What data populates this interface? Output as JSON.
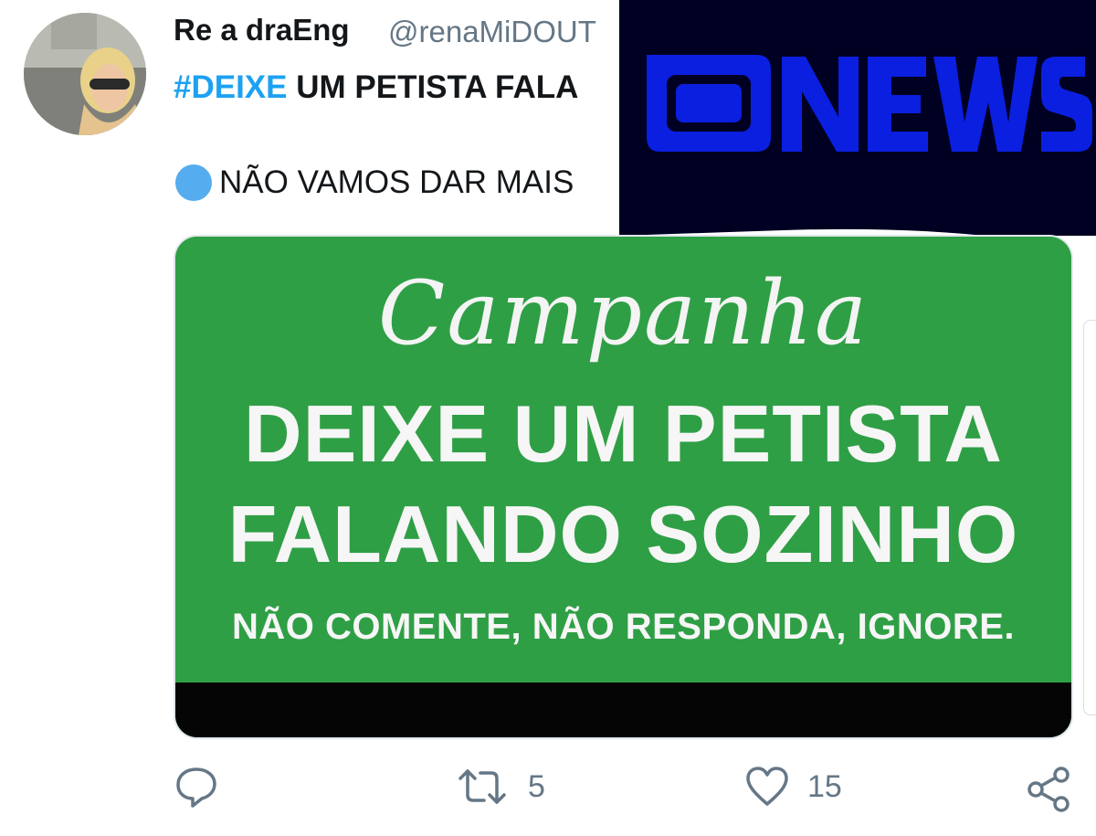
{
  "tweet": {
    "display_name": "Re a draEng",
    "handle": "@renaMiDOUT",
    "hashtag": "#DEIXE",
    "line1_rest": " UM PETISTA FALA",
    "line2_text": "NÃO VAMOS DAR MAIS"
  },
  "overlay": {
    "logo_text": "GNEWS",
    "logo_color": "#0a1fe0",
    "background": "#000022"
  },
  "card": {
    "script_title": "Campanha",
    "headline_line1": "DEIXE UM PETISTA",
    "headline_line2": "FALANDO SOZINHO",
    "subline": "NÃO COMENTE, NÃO RESPONDA, IGNORE.",
    "green": "#2f9f45"
  },
  "actions": {
    "reply_icon": "reply-icon",
    "retweet_icon": "retweet-icon",
    "retweet_count": "5",
    "like_icon": "heart-icon",
    "like_count": "15",
    "share_icon": "share-icon"
  },
  "colors": {
    "hashtag": "#1da1f2",
    "muted": "#657786",
    "text": "#14171a"
  }
}
